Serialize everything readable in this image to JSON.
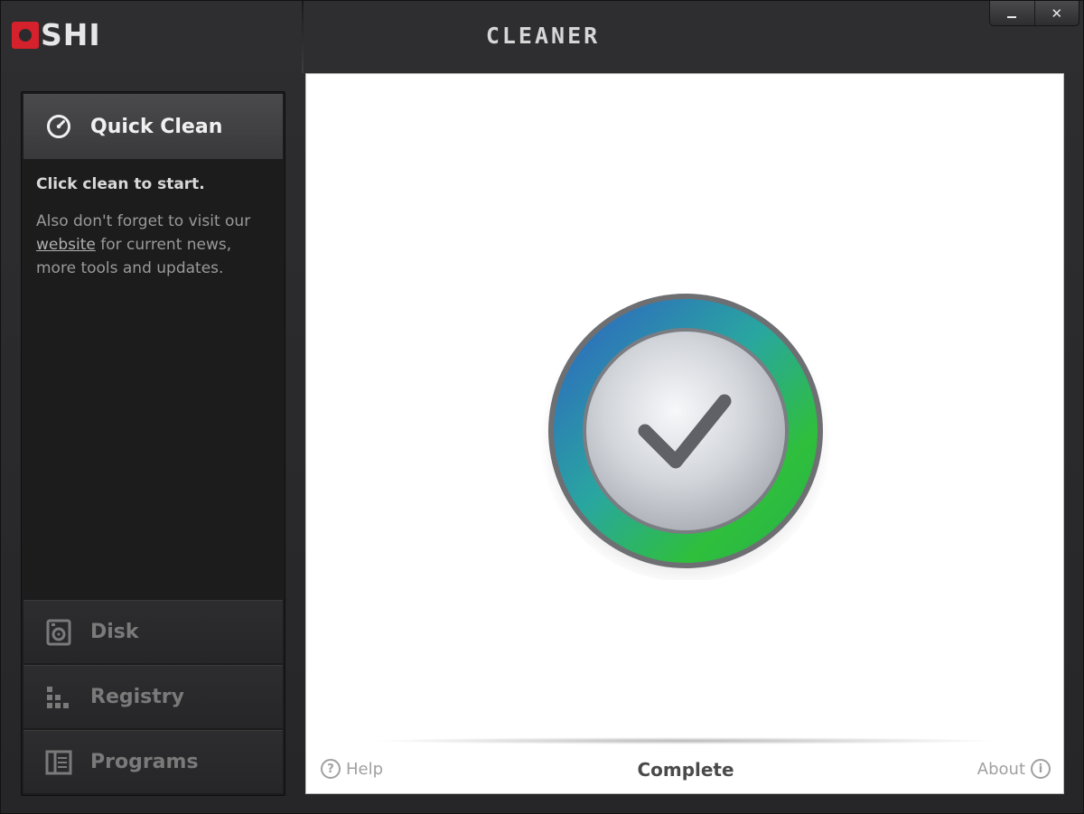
{
  "window": {
    "logo_text": "SHI",
    "app_title": "CLEANER",
    "controls": {
      "minimize_icon": "minimize-icon",
      "close_symbol": "✕"
    }
  },
  "sidebar": {
    "active": {
      "label": "Quick Clean",
      "icon": "gauge-icon"
    },
    "description": {
      "title": "Click clean to start.",
      "line_before_link": "Also don't forget to visit our",
      "link_text": "website",
      "line_after_link": " for current news, more tools and updates."
    },
    "items": [
      {
        "label": "Disk",
        "icon": "disk-icon"
      },
      {
        "label": "Registry",
        "icon": "registry-icon"
      },
      {
        "label": "Programs",
        "icon": "programs-icon"
      }
    ]
  },
  "main": {
    "emblem_icon": "checkmark-icon",
    "footer": {
      "help_label": "Help",
      "help_symbol": "?",
      "status": "Complete",
      "about_label": "About",
      "about_symbol": "i"
    }
  },
  "colors": {
    "brand_red": "#d4212b",
    "ring_blue": "#2f5fc4",
    "ring_green": "#2fbf3c",
    "window_bg": "#2a2a2c",
    "sidebar_bg": "#1c1c1d"
  }
}
